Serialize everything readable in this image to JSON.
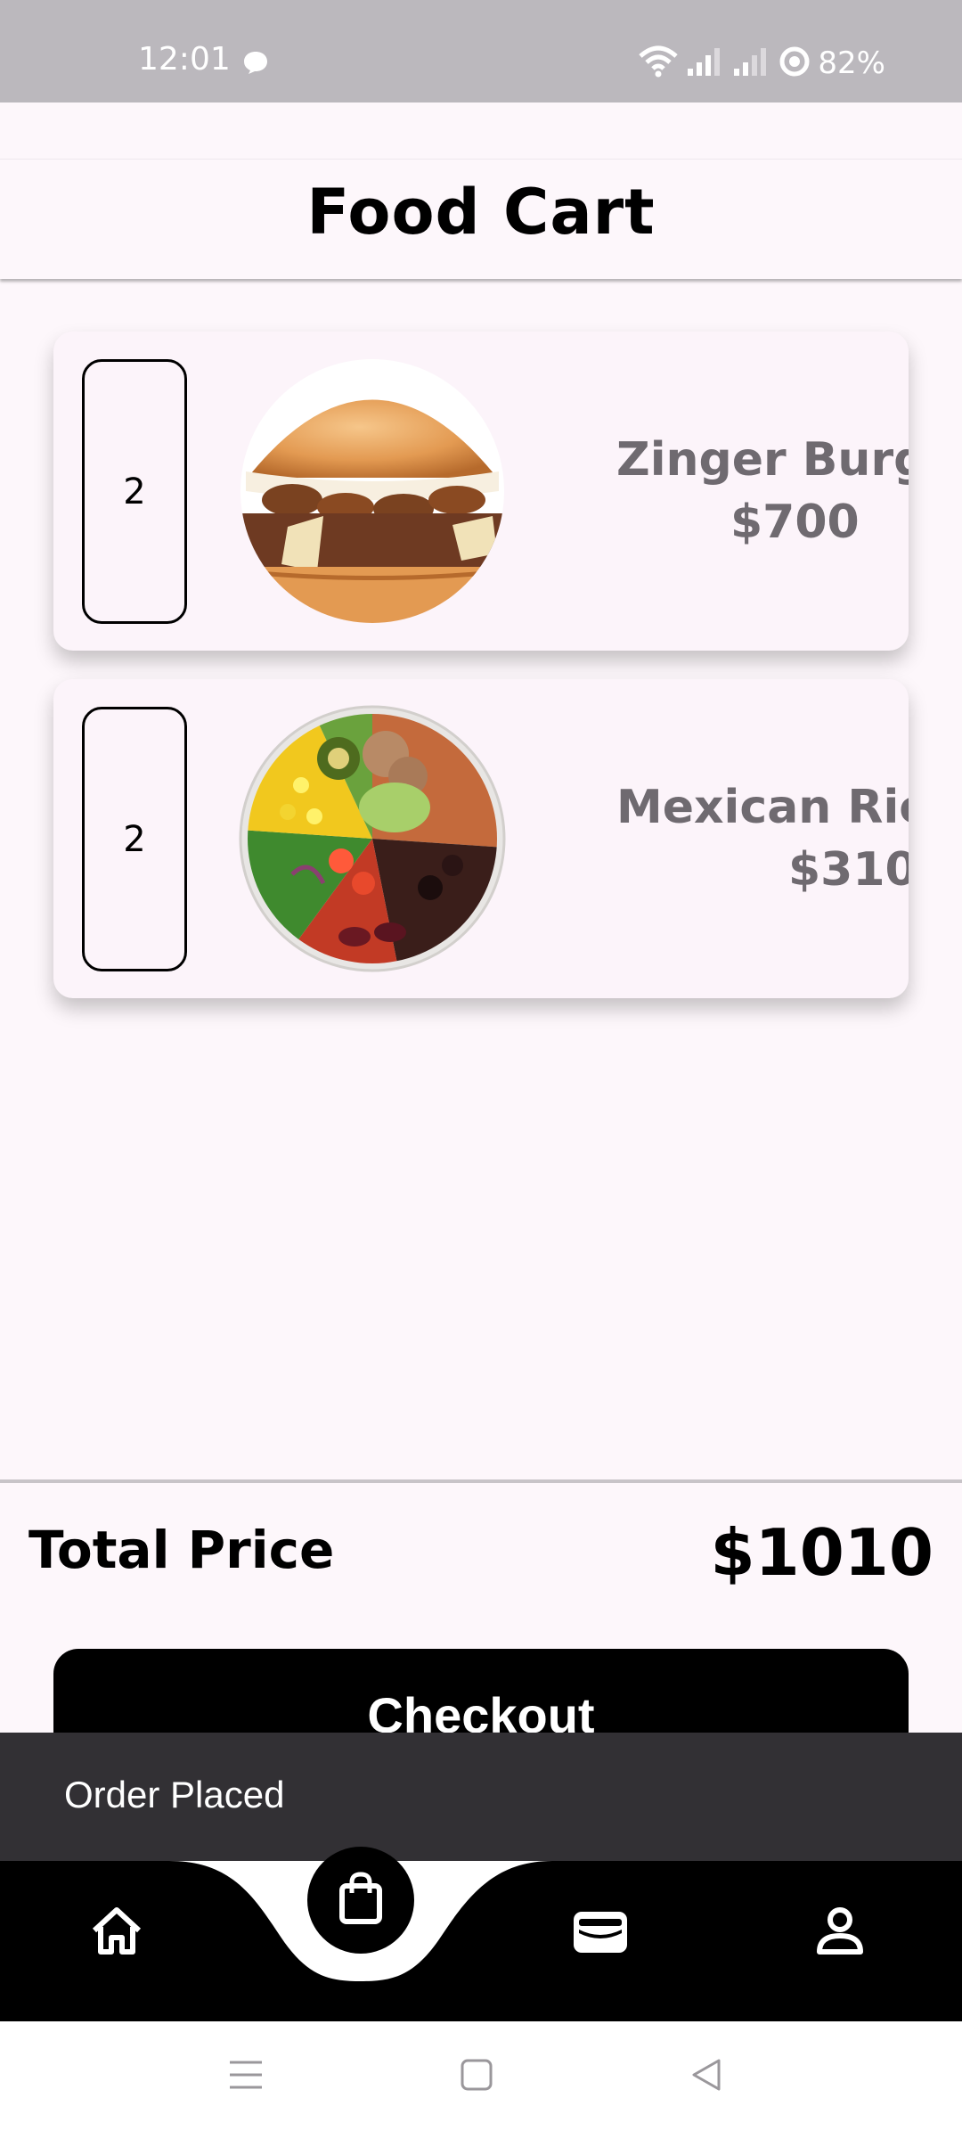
{
  "status_bar": {
    "time": "12:01",
    "battery": "82%"
  },
  "app_bar": {
    "title": "Food Cart"
  },
  "cart": {
    "items": [
      {
        "quantity": "2",
        "name": "Zinger Burger",
        "price": "$700",
        "image": "burger-image"
      },
      {
        "quantity": "2",
        "name": "Mexican Rice Bowl",
        "price": "$310",
        "image": "rice-bowl-image"
      }
    ]
  },
  "summary": {
    "total_label": "Total Price",
    "total_value": "$1010",
    "checkout_label": "Checkout"
  },
  "snackbar": {
    "message": "Order Placed"
  },
  "bottom_nav": {
    "items": [
      "home-icon",
      "shopping-bag-icon",
      "wallet-icon",
      "profile-icon"
    ],
    "active": "shopping-bag-icon"
  },
  "system_nav": {
    "items": [
      "recents-icon",
      "home-square-icon",
      "back-icon"
    ]
  }
}
